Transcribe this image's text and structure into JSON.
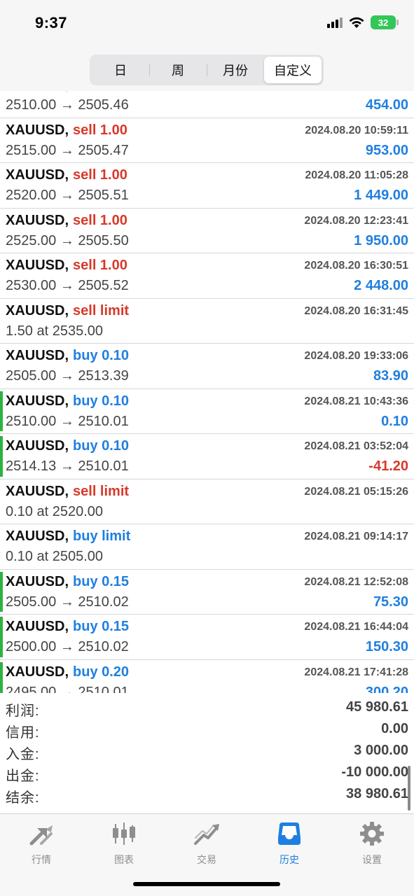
{
  "status_bar": {
    "time": "9:37",
    "battery": "32"
  },
  "period_tabs": [
    "日",
    "周",
    "月份",
    "自定义"
  ],
  "active_period_index": 3,
  "trades": [
    {
      "symbol": "XAUUSD,",
      "type": "",
      "type_color": "red",
      "datetime": "",
      "detail": "2510.00 → 2505.46",
      "profit": "454.00",
      "profit_color": "blue",
      "green_bar": false
    },
    {
      "symbol": "XAUUSD,",
      "type": "sell 1.00",
      "type_color": "red",
      "datetime": "2024.08.20 10:59:11",
      "detail": "2515.00 → 2505.47",
      "profit": "953.00",
      "profit_color": "blue",
      "green_bar": false
    },
    {
      "symbol": "XAUUSD,",
      "type": "sell 1.00",
      "type_color": "red",
      "datetime": "2024.08.20 11:05:28",
      "detail": "2520.00 → 2505.51",
      "profit": "1 449.00",
      "profit_color": "blue",
      "green_bar": false
    },
    {
      "symbol": "XAUUSD,",
      "type": "sell 1.00",
      "type_color": "red",
      "datetime": "2024.08.20 12:23:41",
      "detail": "2525.00 → 2505.50",
      "profit": "1 950.00",
      "profit_color": "blue",
      "green_bar": false
    },
    {
      "symbol": "XAUUSD,",
      "type": "sell 1.00",
      "type_color": "red",
      "datetime": "2024.08.20 16:30:51",
      "detail": "2530.00 → 2505.52",
      "profit": "2 448.00",
      "profit_color": "blue",
      "green_bar": false
    },
    {
      "symbol": "XAUUSD,",
      "type": "sell limit",
      "type_color": "red",
      "datetime": "2024.08.20 16:31:45",
      "detail": "1.50 at 2535.00",
      "profit": "",
      "profit_color": "blue",
      "green_bar": false
    },
    {
      "symbol": "XAUUSD,",
      "type": "buy 0.10",
      "type_color": "blue",
      "datetime": "2024.08.20 19:33:06",
      "detail": "2505.00 → 2513.39",
      "profit": "83.90",
      "profit_color": "blue",
      "green_bar": false
    },
    {
      "symbol": "XAUUSD,",
      "type": "buy 0.10",
      "type_color": "blue",
      "datetime": "2024.08.21 10:43:36",
      "detail": "2510.00 → 2510.01",
      "profit": "0.10",
      "profit_color": "blue",
      "green_bar": true
    },
    {
      "symbol": "XAUUSD,",
      "type": "buy 0.10",
      "type_color": "blue",
      "datetime": "2024.08.21 03:52:04",
      "detail": "2514.13 → 2510.01",
      "profit": "-41.20",
      "profit_color": "red",
      "green_bar": true
    },
    {
      "symbol": "XAUUSD,",
      "type": "sell limit",
      "type_color": "red",
      "datetime": "2024.08.21 05:15:26",
      "detail": "0.10 at 2520.00",
      "profit": "",
      "profit_color": "blue",
      "green_bar": false
    },
    {
      "symbol": "XAUUSD,",
      "type": "buy limit",
      "type_color": "blue",
      "datetime": "2024.08.21 09:14:17",
      "detail": "0.10 at 2505.00",
      "profit": "",
      "profit_color": "blue",
      "green_bar": false
    },
    {
      "symbol": "XAUUSD,",
      "type": "buy 0.15",
      "type_color": "blue",
      "datetime": "2024.08.21 12:52:08",
      "detail": "2505.00 → 2510.02",
      "profit": "75.30",
      "profit_color": "blue",
      "green_bar": true
    },
    {
      "symbol": "XAUUSD,",
      "type": "buy 0.15",
      "type_color": "blue",
      "datetime": "2024.08.21 16:44:04",
      "detail": "2500.00 → 2510.02",
      "profit": "150.30",
      "profit_color": "blue",
      "green_bar": true
    },
    {
      "symbol": "XAUUSD,",
      "type": "buy 0.20",
      "type_color": "blue",
      "datetime": "2024.08.21 17:41:28",
      "detail": "2495.00 → 2510.01",
      "profit": "300.20",
      "profit_color": "blue",
      "green_bar": true
    }
  ],
  "summary": [
    {
      "label": "利润:",
      "value": "45 980.61"
    },
    {
      "label": "信用:",
      "value": "0.00"
    },
    {
      "label": "入金:",
      "value": "3 000.00"
    },
    {
      "label": "出金:",
      "value": "-10 000.00"
    },
    {
      "label": "结余:",
      "value": "38 980.61"
    }
  ],
  "tab_bar": [
    {
      "label": "行情",
      "icon": "quotes-arrows-icon"
    },
    {
      "label": "图表",
      "icon": "candlestick-chart-icon"
    },
    {
      "label": "交易",
      "icon": "trade-trend-icon"
    },
    {
      "label": "历史",
      "icon": "history-inbox-icon"
    },
    {
      "label": "设置",
      "icon": "gear-icon"
    }
  ],
  "active_tab_index": 3,
  "colors": {
    "sell": "#d6392b",
    "buy": "#1f7fe0",
    "active_tab": "#1f7fe0",
    "inactive_tab": "#8e8e8e",
    "position_bar": "#2cb33f"
  }
}
